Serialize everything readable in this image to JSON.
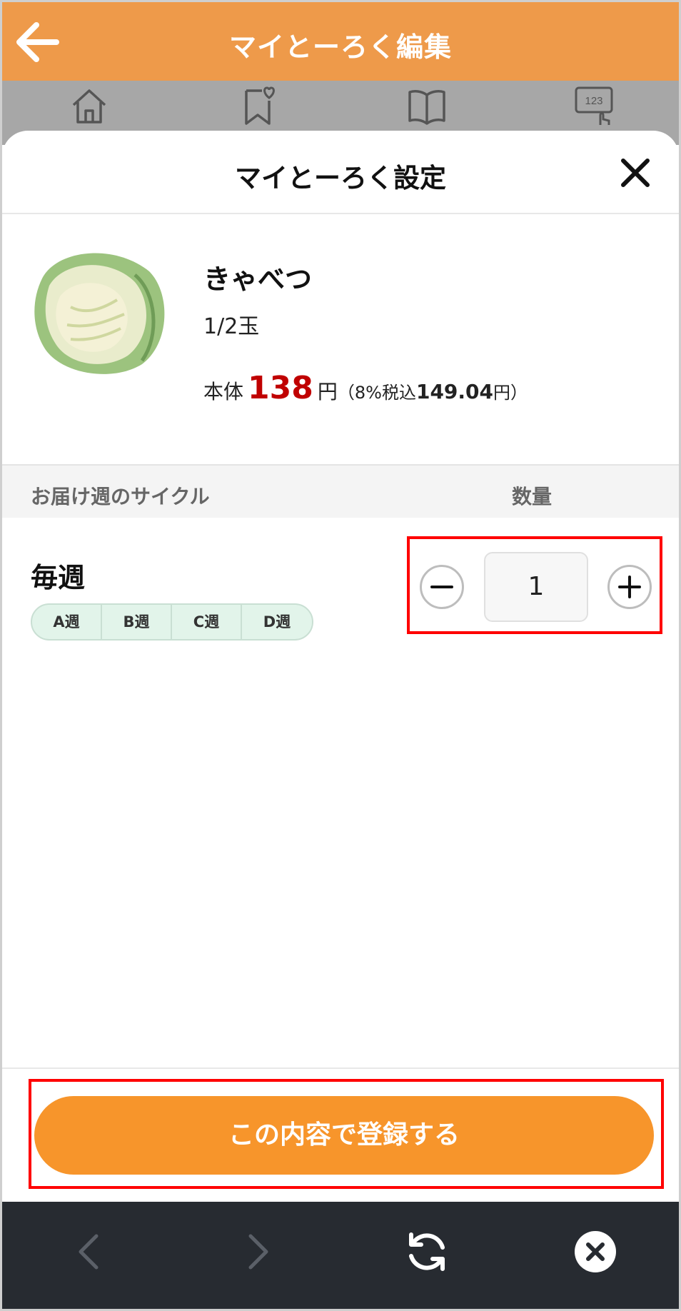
{
  "header": {
    "title": "マイとーろく編集"
  },
  "nav": {
    "icons": [
      "home-icon",
      "bookmark-heart-icon",
      "book-icon",
      "number-touch-icon"
    ],
    "number_label": "123"
  },
  "modal": {
    "title": "マイとーろく設定",
    "product": {
      "name": "きゃべつ",
      "size": "1/2玉",
      "price_prefix": "本体",
      "price": "138",
      "price_unit": "円",
      "tax_prefix": "（8%税込",
      "tax_amount": "149.04",
      "tax_suffix": "円）"
    },
    "columns": {
      "cycle": "お届け週のサイクル",
      "quantity": "数量"
    },
    "cycle": {
      "name": "毎週",
      "weeks": [
        "A週",
        "B週",
        "C週",
        "D週"
      ]
    },
    "quantity": {
      "value": "1"
    },
    "submit_label": "この内容で登録する"
  },
  "colors": {
    "header": "#ee9a4a",
    "accent_button": "#f7952b",
    "price": "#c00000",
    "highlight": "#ff0000",
    "browser_bar": "#272b31"
  }
}
